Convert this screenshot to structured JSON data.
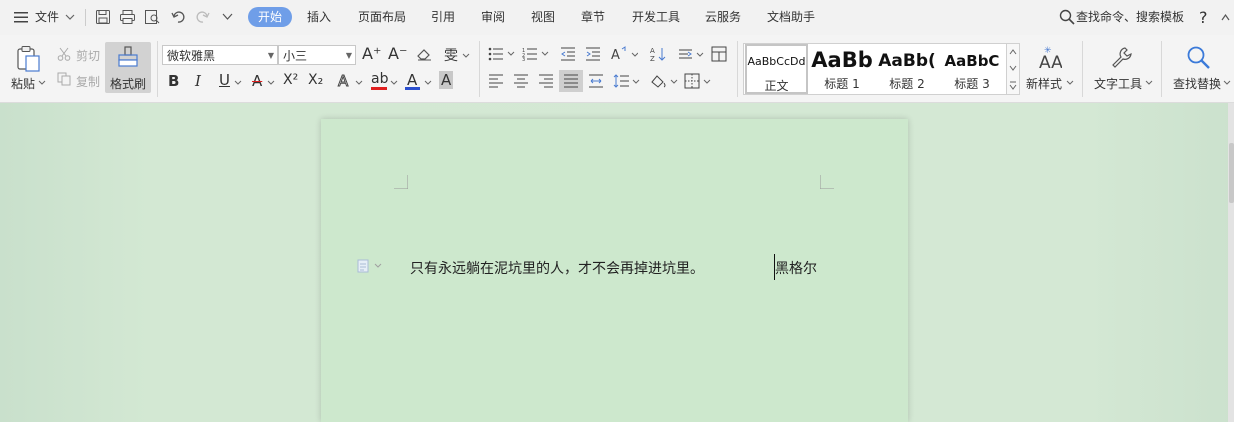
{
  "menubar": {
    "file_menu": "文件",
    "tabs": [
      {
        "label": "开始",
        "active": true
      },
      {
        "label": "插入"
      },
      {
        "label": "页面布局"
      },
      {
        "label": "引用"
      },
      {
        "label": "审阅"
      },
      {
        "label": "视图"
      },
      {
        "label": "章节"
      },
      {
        "label": "开发工具"
      },
      {
        "label": "云服务"
      },
      {
        "label": "文档助手"
      }
    ],
    "search_label": "查找命令、搜索模板",
    "help_label": "?"
  },
  "ribbon": {
    "clipboard": {
      "paste": "粘贴",
      "cut": "剪切",
      "copy": "复制",
      "format_painter": "格式刷"
    },
    "font": {
      "family": "微软雅黑",
      "size": "小三",
      "wen_glyph": "雯",
      "bold": "B",
      "italic": "I",
      "underline": "U",
      "strike": "A",
      "superscript": "X²",
      "subscript": "X₂",
      "effect": "A",
      "highlight": "ab",
      "color": "A",
      "char_shade": "A",
      "grow": "A⁺",
      "shrink": "A⁻"
    },
    "styles": [
      {
        "sample": "AaBbCcDd",
        "name": "正文"
      },
      {
        "sample": "AaBb",
        "name": "标题 1"
      },
      {
        "sample": "AaBb(",
        "name": "标题 2"
      },
      {
        "sample": "AaBbC",
        "name": "标题 3"
      }
    ],
    "new_style": "新样式",
    "text_tools": "文字工具",
    "find_replace": "查找替换"
  },
  "document": {
    "quote": "只有永远躺在泥坑里的人，才不会再掉进坑里。",
    "author": "黑格尔"
  },
  "colors": {
    "accent": "#6f9ee8",
    "page_bg": "#cde8cd",
    "highlight_red": "#e02020",
    "font_color_blue": "#2b4fcf"
  }
}
